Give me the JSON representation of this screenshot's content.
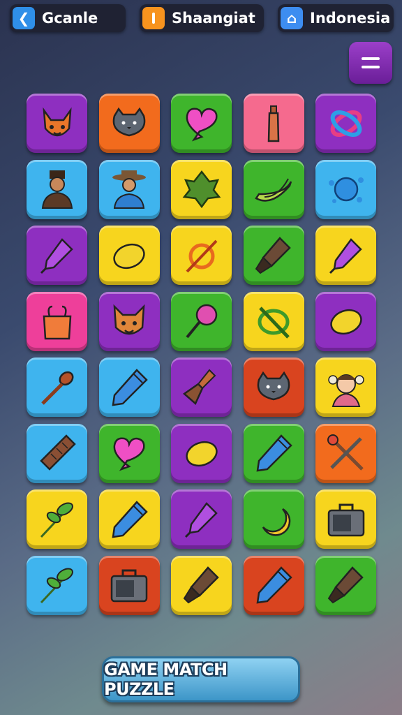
{
  "header": {
    "left": {
      "label": "Gcanle",
      "icon": "back-arrow-icon"
    },
    "center": {
      "label": "Shaangiat",
      "icon": "bar-icon"
    },
    "right": {
      "label": "Indonesia",
      "icon": "home-icon"
    }
  },
  "menu_button": {
    "icon": "menu-icon"
  },
  "colors": {
    "purple": "#8e2fc0",
    "orange": "#f26b1d",
    "green": "#3fb52c",
    "pink": "#f56a8e",
    "blue": "#3fb4ee",
    "yellow": "#f7d51e",
    "red": "#d9441f",
    "magenta": "#ee3f9a"
  },
  "tiles": [
    {
      "icon": "fox-icon",
      "color": "purple"
    },
    {
      "icon": "cat-icon",
      "color": "orange"
    },
    {
      "icon": "heart-icon",
      "color": "green"
    },
    {
      "icon": "bottle-icon",
      "color": "pink"
    },
    {
      "icon": "rings-icon",
      "color": "purple"
    },
    {
      "icon": "man-hat-icon",
      "color": "blue"
    },
    {
      "icon": "cowboy-icon",
      "color": "blue"
    },
    {
      "icon": "artichoke-icon",
      "color": "yellow"
    },
    {
      "icon": "banana-icon",
      "color": "green"
    },
    {
      "icon": "splat-icon",
      "color": "blue"
    },
    {
      "icon": "marker-icon",
      "color": "purple"
    },
    {
      "icon": "lemon-icon",
      "color": "yellow"
    },
    {
      "icon": "pin-ring-icon",
      "color": "yellow"
    },
    {
      "icon": "brush-icon",
      "color": "green"
    },
    {
      "icon": "marker-icon",
      "color": "yellow"
    },
    {
      "icon": "bag-icon",
      "color": "magenta"
    },
    {
      "icon": "dog-icon",
      "color": "purple"
    },
    {
      "icon": "pin-icon",
      "color": "green"
    },
    {
      "icon": "ring-slash-icon",
      "color": "yellow"
    },
    {
      "icon": "lemon-icon",
      "color": "purple"
    },
    {
      "icon": "spoon-icon",
      "color": "blue"
    },
    {
      "icon": "pen-icon",
      "color": "blue"
    },
    {
      "icon": "broom-icon",
      "color": "purple"
    },
    {
      "icon": "cat-icon",
      "color": "red"
    },
    {
      "icon": "girl-icon",
      "color": "yellow"
    },
    {
      "icon": "stick-icon",
      "color": "blue"
    },
    {
      "icon": "heart-icon",
      "color": "green"
    },
    {
      "icon": "lemon-icon",
      "color": "purple"
    },
    {
      "icon": "pen-icon",
      "color": "green"
    },
    {
      "icon": "crossed-tools-icon",
      "color": "orange"
    },
    {
      "icon": "herb-icon",
      "color": "yellow"
    },
    {
      "icon": "pen-icon",
      "color": "yellow"
    },
    {
      "icon": "marker-icon",
      "color": "purple"
    },
    {
      "icon": "moon-icon",
      "color": "green"
    },
    {
      "icon": "case-icon",
      "color": "yellow"
    },
    {
      "icon": "herb-icon",
      "color": "blue"
    },
    {
      "icon": "case-icon",
      "color": "red"
    },
    {
      "icon": "brush-icon",
      "color": "yellow"
    },
    {
      "icon": "pen-icon",
      "color": "red"
    },
    {
      "icon": "brush-icon",
      "color": "green"
    }
  ],
  "footer": {
    "button_label": "GAME MATCH PUZZLE"
  }
}
